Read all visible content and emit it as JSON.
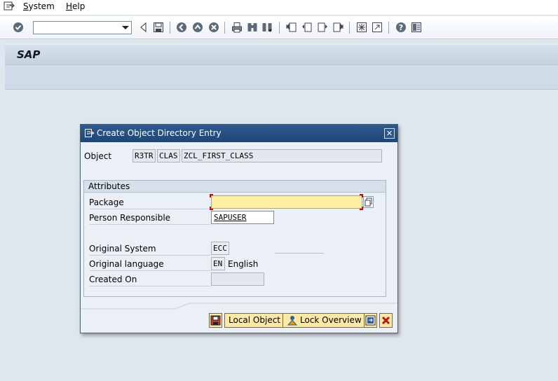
{
  "menubar": {
    "system_icon": "system-menu-icon",
    "items": [
      "System",
      "Help"
    ]
  },
  "toolbar": {
    "command_field_value": "",
    "icons": [
      "enter-icon",
      "back-arrow-icon",
      "save-icon",
      "back-icon",
      "exit-icon",
      "cancel-icon",
      "print-icon",
      "find-icon",
      "find-next-icon",
      "first-page-icon",
      "previous-page-icon",
      "next-page-icon",
      "last-page-icon",
      "new-session-icon",
      "create-shortcut-icon",
      "help-icon",
      "customize-layout-icon"
    ]
  },
  "titlebar": {
    "title": "SAP"
  },
  "dialog": {
    "title": "Create Object Directory Entry",
    "object": {
      "label": "Object",
      "pgmid": "R3TR",
      "type": "CLAS",
      "name": "ZCL_FIRST_CLASS"
    },
    "attributes": {
      "header": "Attributes",
      "package_label": "Package",
      "package_value": "",
      "person_label": "Person Responsible",
      "person_value": "SAPUSER",
      "system_label": "Original System",
      "system_value": "ECC",
      "language_label": "Original language",
      "language_code": "EN",
      "language_text": "English",
      "created_label": "Created On",
      "created_value": ""
    },
    "buttons": {
      "save_icon": "save-icon",
      "local_object": "Local Object",
      "lock_overview": "Lock Overview",
      "overview_icon": "transport-icon",
      "cancel_icon": "cancel-x-icon"
    }
  },
  "colors": {
    "required_field": "#fdf19f",
    "button": "#fbe9a6",
    "dialog_header": "#1e4676"
  }
}
